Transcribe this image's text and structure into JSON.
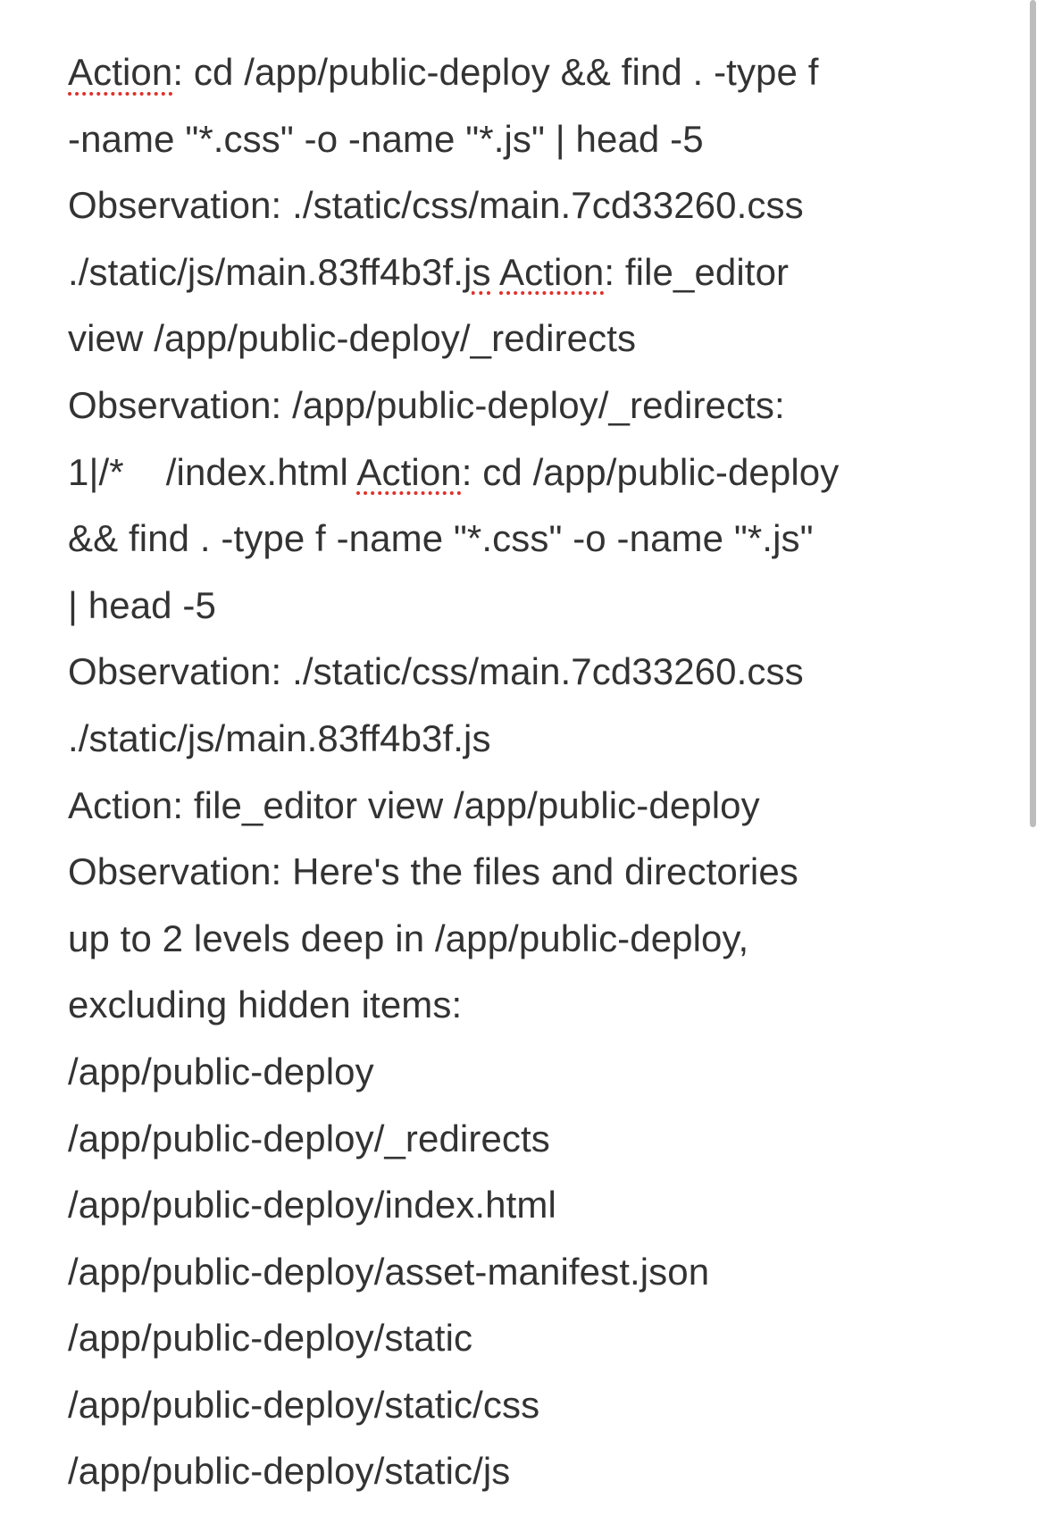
{
  "note": {
    "lines": [
      [
        {
          "t": "Action",
          "spell": true
        },
        {
          "t": ": cd /app/public-deploy && find . -type f"
        }
      ],
      [
        {
          "t": "-name \"*.css\" -o -name \"*.js\" | head -5"
        }
      ],
      [
        {
          "t": "Observation: ./static/css/main.7cd33260.css"
        }
      ],
      [
        {
          "t": "./static/js/main.83ff4b3f."
        },
        {
          "t": "js",
          "spell": true
        },
        {
          "t": " "
        },
        {
          "t": "Action",
          "spell": true
        },
        {
          "t": ": file_editor"
        }
      ],
      [
        {
          "t": "view /app/public-deploy/_redirects"
        }
      ],
      [
        {
          "t": "Observation: /app/public-deploy/_redirects:"
        }
      ],
      [
        {
          "t": "1|/*    /index.html "
        },
        {
          "t": "Action",
          "spell": true
        },
        {
          "t": ": cd /app/public-deploy"
        }
      ],
      [
        {
          "t": "&& find . -type f -name \"*.css\" -o -name \"*.js\""
        }
      ],
      [
        {
          "t": "| head -5"
        }
      ],
      [
        {
          "t": "Observation: ./static/css/main.7cd33260.css"
        }
      ],
      [
        {
          "t": "./static/js/main.83ff4b3f.js"
        }
      ],
      [
        {
          "t": "Action: file_editor view /app/public-deploy"
        }
      ],
      [
        {
          "t": "Observation: Here's the files and directories"
        }
      ],
      [
        {
          "t": "up to 2 levels deep in /app/public-deploy,"
        }
      ],
      [
        {
          "t": "excluding hidden items:"
        }
      ],
      [
        {
          "t": "/app/public-deploy"
        }
      ],
      [
        {
          "t": "/app/public-deploy/_redirects"
        }
      ],
      [
        {
          "t": "/app/public-deploy/index.html"
        }
      ],
      [
        {
          "t": "/app/public-deploy/asset-manifest.json"
        }
      ],
      [
        {
          "t": "/app/public-deploy/static"
        }
      ],
      [
        {
          "t": "/app/public-deploy/static/css"
        }
      ],
      [
        {
          "t": "/app/public-deploy/static/js"
        }
      ]
    ]
  },
  "colors": {
    "text": "#333333",
    "spellcheck_underline": "#e0302a",
    "background": "#ffffff",
    "scrollbar": "#bdbdbd"
  },
  "scroll": {
    "position_fraction": 0.0,
    "visible_fraction": 0.54
  }
}
